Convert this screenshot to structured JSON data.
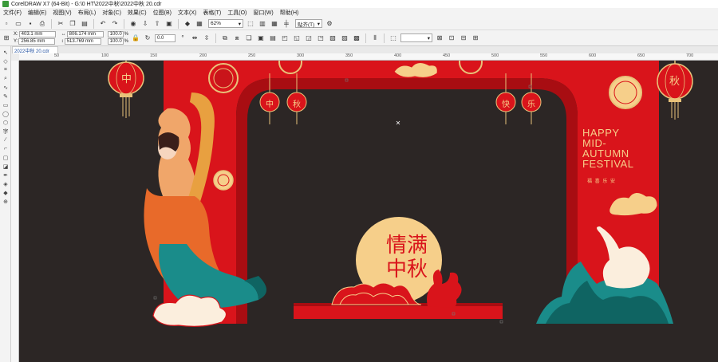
{
  "window": {
    "title": "CorelDRAW X7 (64-Bit) - G:\\0 HT\\2022中秋\\2022中秋 20.cdr"
  },
  "menu": [
    "文件(F)",
    "编辑(E)",
    "视图(V)",
    "布局(L)",
    "对象(C)",
    "效果(C)",
    "位图(B)",
    "文本(X)",
    "表格(T)",
    "工具(O)",
    "窗口(W)",
    "帮助(H)"
  ],
  "toolbar": {
    "zoom": "62%",
    "snap_label": "贴齐(T)"
  },
  "property_bar": {
    "x_label": "X:",
    "x_value": "403.1 mm",
    "y_label": "Y:",
    "y_value": "256.85 mm",
    "width_value": "806.174 mm",
    "height_value": "513.769 mm",
    "scale_w": "100.0",
    "scale_h": "100.0",
    "percent": "%",
    "rotation": "0.0"
  },
  "document_tab": {
    "label": "2022中秋 20.cdr"
  },
  "ruler": {
    "ticks": [
      "50",
      "100",
      "150",
      "200",
      "250",
      "300",
      "350",
      "400",
      "450",
      "500",
      "550",
      "600",
      "650",
      "700"
    ]
  },
  "design": {
    "lantern_left_big": "中",
    "lantern_right_big": "秋",
    "small_lanterns": [
      "中",
      "秋",
      "快",
      "乐"
    ],
    "happy_lines": [
      "HAPPY",
      "MID-",
      "AUTUMN",
      "FESTIVAL"
    ],
    "seal_text": "福 喜 乐 安",
    "calligraphy_top": "情满",
    "calligraphy_bottom": "中秋"
  },
  "colors": {
    "canvas": "#2c2625",
    "red": "#d9141b",
    "dark_red": "#a80d12",
    "gold": "#e8c27a",
    "moon": "#f6cf8a",
    "teal": "#1a8c8a"
  }
}
